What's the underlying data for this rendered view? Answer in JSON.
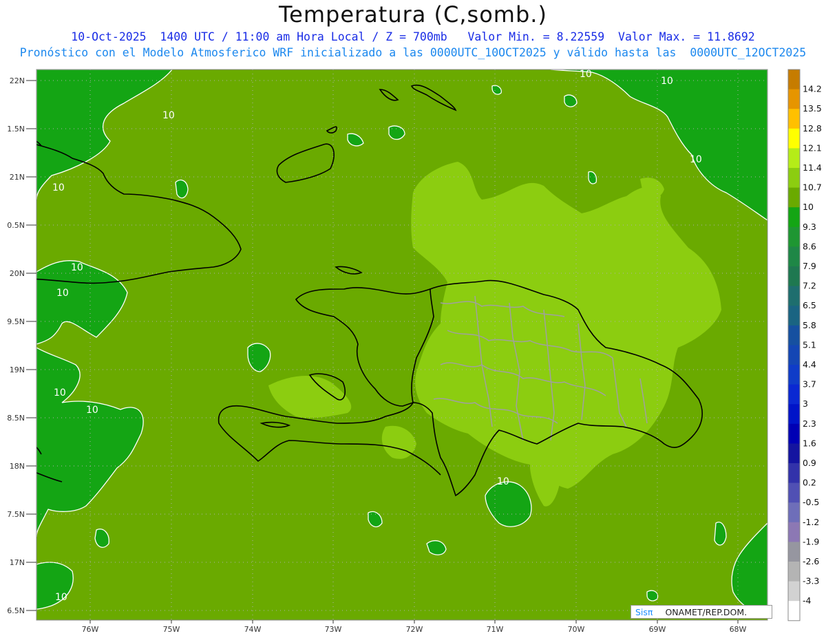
{
  "header": {
    "title": "Temperatura (C,somb.)",
    "subtitle1": "10-Oct-2025  1400 UTC / 11:00 am Hora Local / Z = 700mb   Valor Min. = 8.22559  Valor Max. = 11.8692",
    "subtitle2": "Pronóstico con el Modelo Atmosferico WRF inicializado a las 0000UTC_10OCT2025 y válido hasta las  0000UTC_12OCT2025"
  },
  "map": {
    "lat_labels": [
      "22N",
      "1.5N",
      "21N",
      "0.5N",
      "20N",
      "9.5N",
      "19N",
      "8.5N",
      "18N",
      "7.5N",
      "17N",
      "6.5N"
    ],
    "lon_labels": [
      "76W",
      "75W",
      "74W",
      "73W",
      "72W",
      "71W",
      "70W",
      "69W",
      "68W"
    ],
    "contour_labels": [
      "10",
      "10",
      "10",
      "10",
      "10",
      "10",
      "10",
      "10",
      "10",
      "10",
      "10"
    ],
    "colors": {
      "field_10": "#6aaa00",
      "field_10_7": "#8ccd10",
      "field_9_3": "#14a514",
      "coastline": "#000000",
      "provinces": "#a0a0a0",
      "contour": "#ffffff"
    }
  },
  "colorbar": {
    "levels": [
      {
        "label": "14.2",
        "color": "#c67c00"
      },
      {
        "label": "13.5",
        "color": "#e69500"
      },
      {
        "label": "12.8",
        "color": "#ffc000"
      },
      {
        "label": "12.1",
        "color": "#ffff00"
      },
      {
        "label": "11.4",
        "color": "#b5ec18"
      },
      {
        "label": "10.7",
        "color": "#8ccd10"
      },
      {
        "label": "10",
        "color": "#6aaa00"
      },
      {
        "label": "9.3",
        "color": "#14a514"
      },
      {
        "label": "8.6",
        "color": "#1e9632"
      },
      {
        "label": "7.9",
        "color": "#1e8746"
      },
      {
        "label": "7.2",
        "color": "#1e7850"
      },
      {
        "label": "6.5",
        "color": "#1e6e6e"
      },
      {
        "label": "5.8",
        "color": "#1a6482"
      },
      {
        "label": "5.1",
        "color": "#1650a0"
      },
      {
        "label": "4.4",
        "color": "#1446b4"
      },
      {
        "label": "3.7",
        "color": "#0f3cc8"
      },
      {
        "label": "3",
        "color": "#0a28d2"
      },
      {
        "label": "2.3",
        "color": "#0014c8"
      },
      {
        "label": "1.6",
        "color": "#0000b4"
      },
      {
        "label": "0.9",
        "color": "#1414a0"
      },
      {
        "label": "0.2",
        "color": "#3232aa"
      },
      {
        "label": "-0.5",
        "color": "#5050b4"
      },
      {
        "label": "-1.2",
        "color": "#6e6eb9"
      },
      {
        "label": "-1.9",
        "color": "#8c78b4"
      },
      {
        "label": "-2.6",
        "color": "#9696a0"
      },
      {
        "label": "-3.3",
        "color": "#b4b4b4"
      },
      {
        "label": "-4",
        "color": "#d2d2d2"
      },
      {
        "label": "",
        "color": "#ffffff"
      }
    ]
  },
  "credit": {
    "sis": "Sisπ",
    "org": "ONAMET/REP.DOM."
  }
}
